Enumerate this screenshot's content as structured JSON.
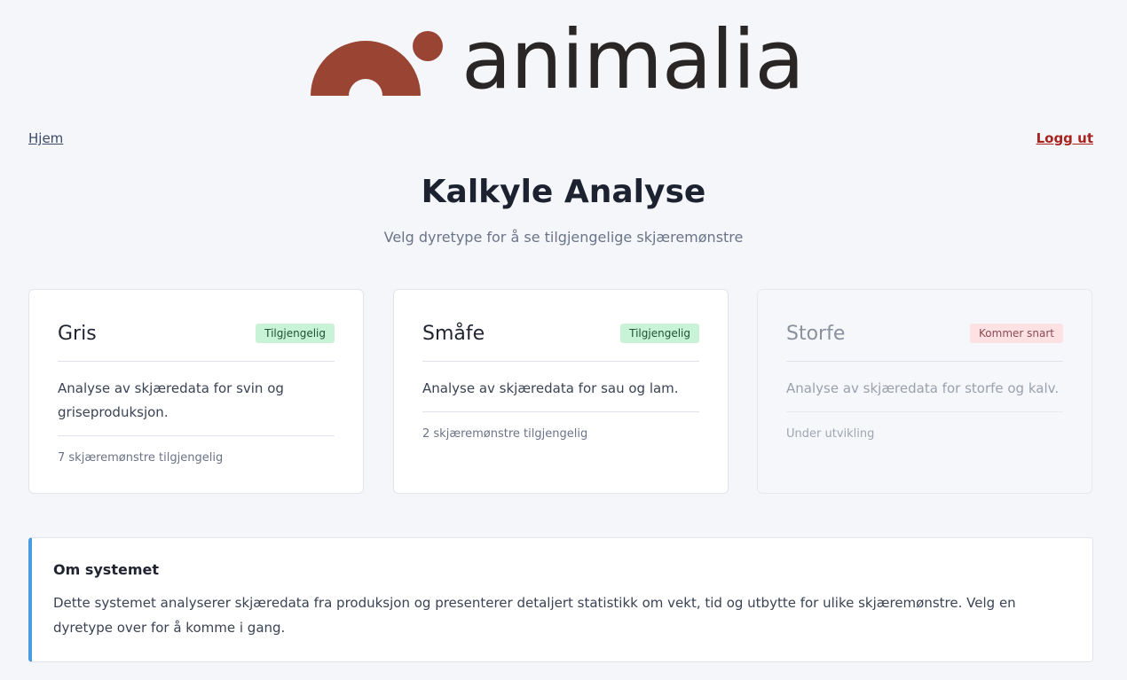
{
  "brand": {
    "name": "animalia",
    "colors": {
      "mark": "#9a4534",
      "wordmark": "#2a2625"
    }
  },
  "nav": {
    "home_label": "Hjem",
    "logout_label": "Logg ut"
  },
  "header": {
    "title": "Kalkyle Analyse",
    "subtitle": "Velg dyretype for å se tilgjengelige skjæremønstre"
  },
  "cards": [
    {
      "title": "Gris",
      "badge": "Tilgjengelig",
      "description": "Analyse av skjæredata for svin og griseproduksjon.",
      "count": "7 skjæremønstre tilgjengelig"
    },
    {
      "title": "Småfe",
      "badge": "Tilgjengelig",
      "description": "Analyse av skjæredata for sau og lam.",
      "count": "2 skjæremønstre tilgjengelig"
    },
    {
      "title": "Storfe",
      "badge": "Kommer snart",
      "description": "Analyse av skjæredata for storfe og kalv.",
      "count": "Under utvikling"
    }
  ],
  "info": {
    "title": "Om systemet",
    "text": "Dette systemet analyserer skjæredata fra produksjon og presenterer detaljert statistikk om vekt, tid og utbytte for ulike skjæremønstre. Velg en dyretype over for å komme i gang."
  },
  "status_colors": {
    "available_bg": "#c9f3d6",
    "soon_bg": "#fde1e3",
    "logout": "#a8231e",
    "info_accent": "#4a9be0"
  }
}
